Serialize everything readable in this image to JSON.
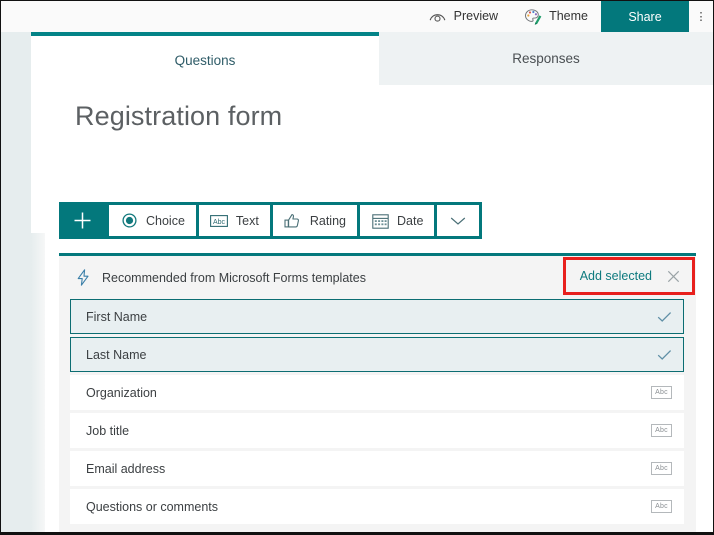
{
  "topbar": {
    "preview": {
      "label": "Preview",
      "icon": "eye-icon"
    },
    "theme": {
      "label": "Theme",
      "icon": "palette-icon"
    },
    "share": {
      "label": "Share"
    },
    "more": {
      "label": "⋮"
    }
  },
  "tabs": [
    {
      "label": "Questions",
      "active": true
    },
    {
      "label": "Responses",
      "active": false
    }
  ],
  "form": {
    "title": "Registration form"
  },
  "question_toolbar": {
    "add_label": "+",
    "items": [
      {
        "label": "Choice",
        "icon": "radio-circle-icon"
      },
      {
        "label": "Text",
        "icon": "abc-box-icon"
      },
      {
        "label": "Rating",
        "icon": "thumbs-up-icon"
      },
      {
        "label": "Date",
        "icon": "calendar-icon"
      }
    ],
    "more_icon": "chevron-down-icon"
  },
  "suggestions": {
    "header": "Recommended from Microsoft Forms templates",
    "header_icon": "lightning-bolt-icon",
    "add_selected_label": "Add selected",
    "close_icon": "close-x-icon",
    "rows": [
      {
        "label": "First Name",
        "selected": true,
        "icon": "check-icon"
      },
      {
        "label": "Last Name",
        "selected": true,
        "icon": "check-icon"
      },
      {
        "label": "Organization",
        "selected": false,
        "icon": "abc-icon",
        "icon_text": "Abc"
      },
      {
        "label": "Job title",
        "selected": false,
        "icon": "abc-icon",
        "icon_text": "Abc"
      },
      {
        "label": "Email address",
        "selected": false,
        "icon": "abc-icon",
        "icon_text": "Abc"
      },
      {
        "label": "Questions or comments",
        "selected": false,
        "icon": "abc-icon",
        "icon_text": "Abc"
      }
    ]
  },
  "colors": {
    "brand_teal": "#03787c",
    "tab_accent": "#038387",
    "highlight_red": "#e8201d",
    "selected_row_bg": "#e8eff1",
    "panel_bg": "#f4f4f4"
  }
}
